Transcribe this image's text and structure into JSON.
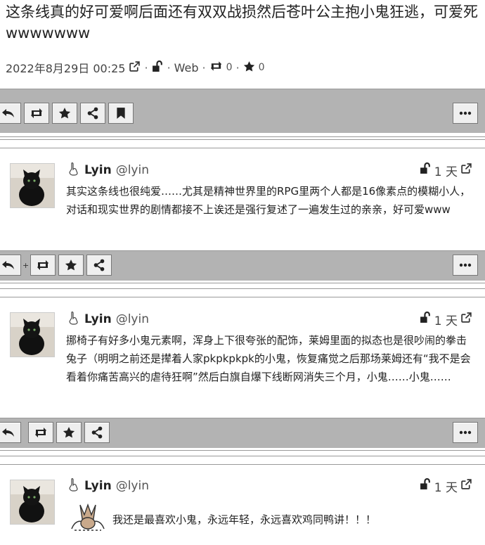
{
  "status": {
    "title": "这条线真的好可爱啊后面还有双双战损然后苍叶公主抱小鬼狂逃，可爱死wwwwwww",
    "timestamp": "2022年8月29日 00:25",
    "sep": "·",
    "source": "Web",
    "repeats": "0",
    "favs": "0"
  },
  "replies": [
    {
      "name": "Lyin",
      "handle": "@lyin",
      "age": "1 天",
      "text": "其实这条线也很纯爱……尤其是精神世界里的RPG里两个人都是16像素点的模糊小人，对话和现实世界的剧情都接不上诶还是强行复述了一遍发生过的亲亲，好可爱www"
    },
    {
      "name": "Lyin",
      "handle": "@lyin",
      "age": "1 天",
      "text": "挪椅子有好多小鬼元素啊，浑身上下很夸张的配饰，莱姆里面的拟态也是很吵闹的拳击兔子（明明之前还是撵着人家pkpkpkpk的小鬼，恢复痛觉之后那场莱姆还有“我不是会看着你痛苦高兴的虐待狂啊”然后白旗自爆下线断网消失三个月，小鬼……小鬼……"
    },
    {
      "name": "Lyin",
      "handle": "@lyin",
      "age": "1 天",
      "text": "我还是最喜欢小鬼，永远年轻，永远喜欢鸡同鸭讲！！！"
    }
  ],
  "actions": {
    "plus": "+"
  },
  "icons": [
    "reply-icon",
    "repeat-icon",
    "star-icon",
    "share-icon",
    "bookmark-icon",
    "more-icon",
    "external-link-icon",
    "unlock-icon",
    "bot-hand-icon"
  ]
}
